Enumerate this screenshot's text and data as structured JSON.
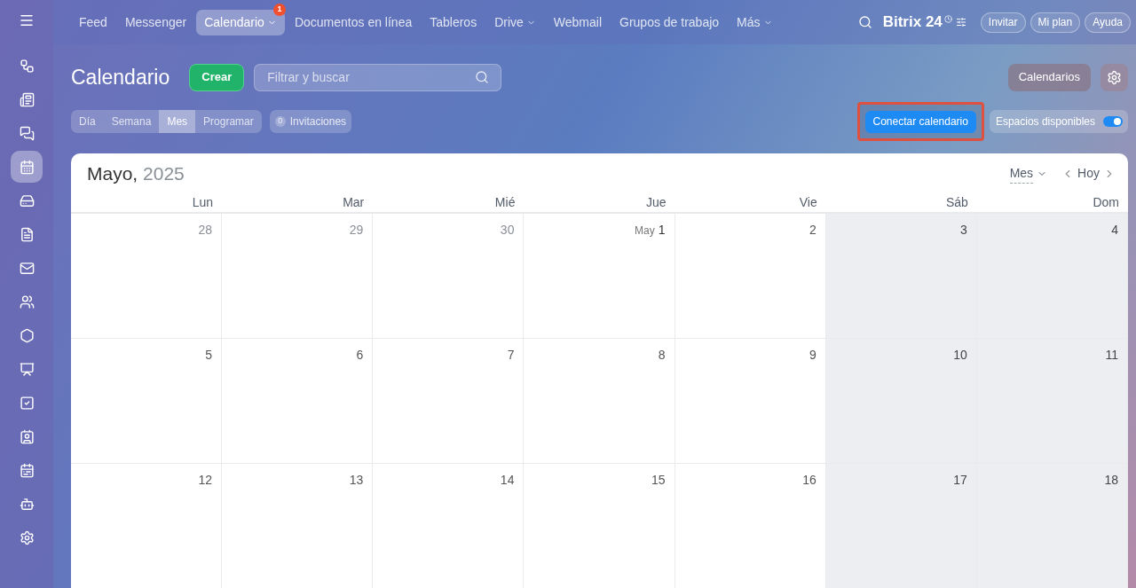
{
  "top_nav": {
    "items": [
      {
        "label": "Feed",
        "selected": false,
        "dropdown": false
      },
      {
        "label": "Messenger",
        "selected": false,
        "dropdown": false
      },
      {
        "label": "Calendario",
        "selected": true,
        "dropdown": true,
        "badge": "1"
      },
      {
        "label": "Documentos en línea",
        "selected": false,
        "dropdown": false
      },
      {
        "label": "Tableros",
        "selected": false,
        "dropdown": false
      },
      {
        "label": "Drive",
        "selected": false,
        "dropdown": true
      },
      {
        "label": "Webmail",
        "selected": false,
        "dropdown": false
      },
      {
        "label": "Grupos de trabajo",
        "selected": false,
        "dropdown": false
      },
      {
        "label": "Más",
        "selected": false,
        "dropdown": true
      }
    ],
    "brand": "Bitrix",
    "brand_number": "24",
    "buttons": [
      "Invitar",
      "Mi plan",
      "Ayuda"
    ]
  },
  "sidebar": {
    "items": [
      {
        "selected": false
      },
      {
        "selected": false
      },
      {
        "selected": false
      },
      {
        "selected": true
      },
      {
        "selected": false
      },
      {
        "selected": false
      },
      {
        "selected": false
      },
      {
        "selected": false
      },
      {
        "selected": false
      },
      {
        "selected": false
      },
      {
        "selected": false
      },
      {
        "selected": false
      },
      {
        "selected": false
      },
      {
        "selected": false
      },
      {
        "selected": false
      }
    ]
  },
  "header": {
    "title": "Calendario",
    "create_button": "Crear",
    "search": {
      "placeholder": "Filtrar y buscar"
    },
    "calendars_button": "Calendarios"
  },
  "view_tabs": [
    {
      "label": "Día",
      "selected": false
    },
    {
      "label": "Semana",
      "selected": false
    },
    {
      "label": "Mes",
      "selected": true
    },
    {
      "label": "Programar",
      "selected": false
    }
  ],
  "invitations": {
    "count": "0",
    "label": "Invitaciones"
  },
  "connect_button": {
    "label": "Conectar calendario",
    "highlighted": true
  },
  "free_slots": {
    "label": "Espacios disponibles",
    "on": true
  },
  "calendar": {
    "month": "Mayo,",
    "year": "2025",
    "view_select": "Mes",
    "today_button": "Hoy",
    "weekdays": [
      "Lun",
      "Mar",
      "Mié",
      "Jue",
      "Vie",
      "Sáb",
      "Dom"
    ],
    "weeks": [
      [
        {
          "day": "28",
          "weekend": false
        },
        {
          "day": "29",
          "weekend": false
        },
        {
          "day": "30",
          "weekend": false
        },
        {
          "day": "1",
          "prefix": "May",
          "weekend": false
        },
        {
          "day": "2",
          "weekend": false
        },
        {
          "day": "3",
          "weekend": true
        },
        {
          "day": "4",
          "weekend": true
        }
      ],
      [
        {
          "day": "5",
          "weekend": false
        },
        {
          "day": "6",
          "weekend": false
        },
        {
          "day": "7",
          "weekend": false
        },
        {
          "day": "8",
          "weekend": false
        },
        {
          "day": "9",
          "weekend": false
        },
        {
          "day": "10",
          "weekend": true
        },
        {
          "day": "11",
          "weekend": true
        }
      ],
      [
        {
          "day": "12",
          "weekend": false
        },
        {
          "day": "13",
          "weekend": false
        },
        {
          "day": "14",
          "weekend": false
        },
        {
          "day": "15",
          "weekend": false
        },
        {
          "day": "16",
          "weekend": false
        },
        {
          "day": "17",
          "weekend": true
        },
        {
          "day": "18",
          "weekend": true
        }
      ]
    ]
  }
}
